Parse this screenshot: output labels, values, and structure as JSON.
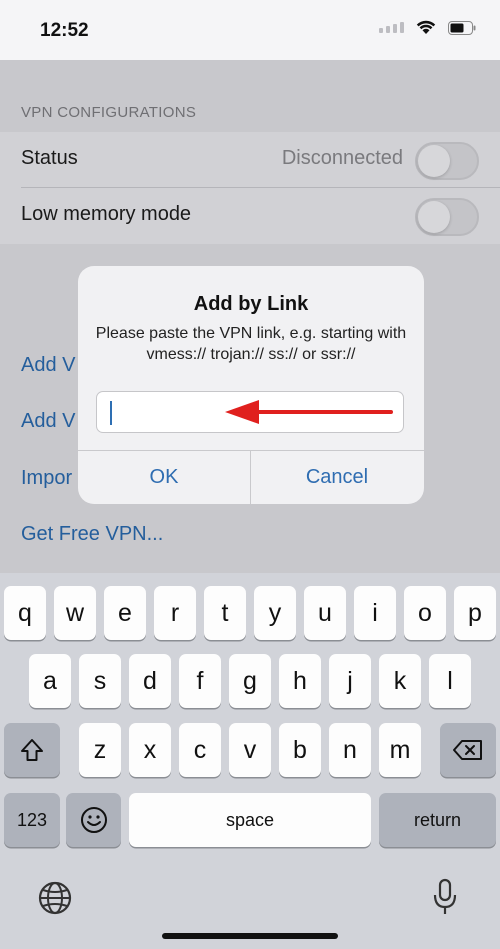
{
  "status_bar": {
    "time": "12:52"
  },
  "settings": {
    "section_header": "VPN CONFIGURATIONS",
    "status_label": "Status",
    "status_value": "Disconnected",
    "status_toggle_on": false,
    "low_memory_label": "Low memory mode",
    "low_memory_toggle_on": false,
    "actions": [
      "Add V",
      "Add V",
      "Impor",
      "Get Free VPN..."
    ]
  },
  "alert": {
    "title": "Add by Link",
    "message": "Please paste the VPN link, e.g. starting with vmess:// trojan:// ss:// or ssr://",
    "input_value": "",
    "ok_label": "OK",
    "cancel_label": "Cancel"
  },
  "keyboard": {
    "row1": [
      "q",
      "w",
      "e",
      "r",
      "t",
      "y",
      "u",
      "i",
      "o",
      "p"
    ],
    "row2": [
      "a",
      "s",
      "d",
      "f",
      "g",
      "h",
      "j",
      "k",
      "l"
    ],
    "row3": [
      "z",
      "x",
      "c",
      "v",
      "b",
      "n",
      "m"
    ],
    "numbers_label": "123",
    "space_label": "space",
    "return_label": "return"
  },
  "colors": {
    "accent": "#2f6db1",
    "arrow": "#e0201e"
  }
}
